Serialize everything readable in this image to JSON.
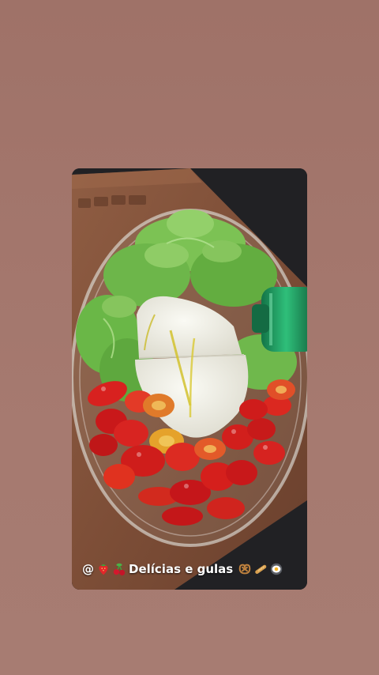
{
  "story": {
    "caption": {
      "at_symbol": "@",
      "title": "Delícias e gulas",
      "leading_icons": [
        "strawberry-icon",
        "cherries-icon"
      ],
      "trailing_icons": [
        "pretzel-icon",
        "baguette-icon",
        "fried-egg-icon"
      ]
    },
    "photo": {
      "subject": "glass-bowl-with-lettuce-burrata-and-tomatoes",
      "board_engraving": "",
      "colors": {
        "board": "#8a5a40",
        "counter": "#1e1e21",
        "lettuce": "#6fb64a",
        "cheese": "#efeee6",
        "tomato": "#d8211f",
        "olive_oil": "#d2c22e",
        "bottle": "#1f9a5e"
      }
    }
  }
}
